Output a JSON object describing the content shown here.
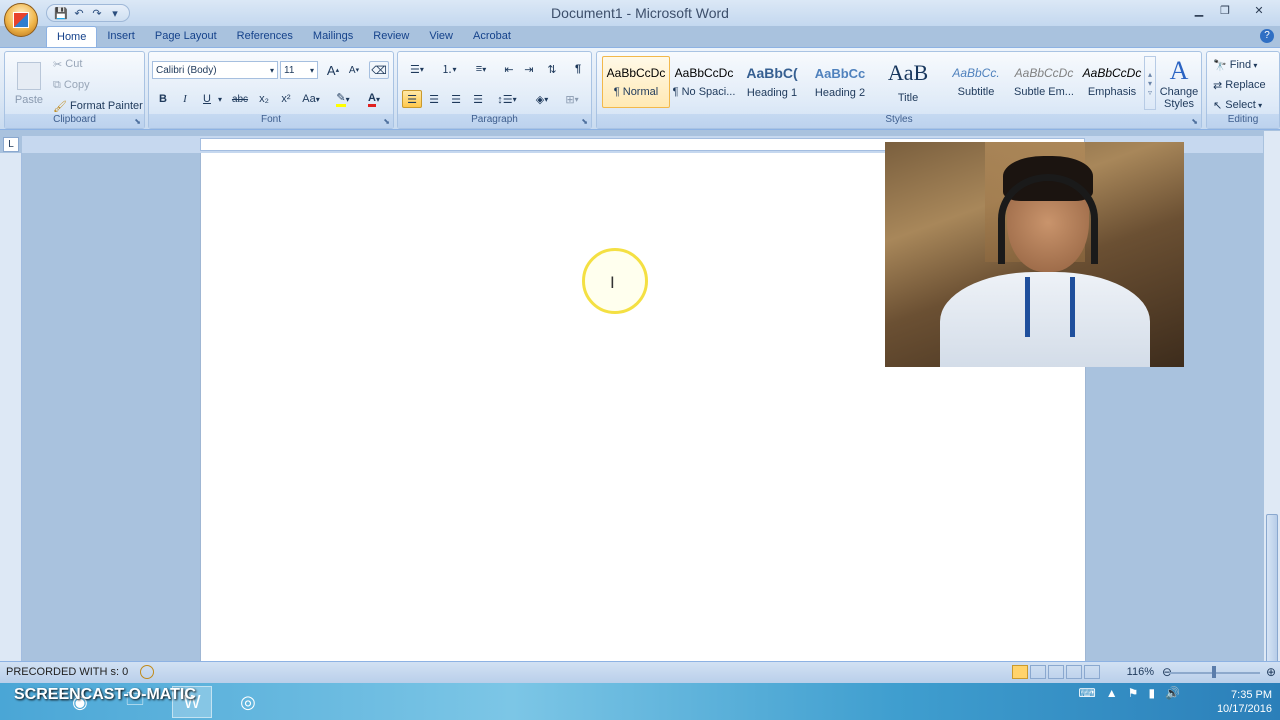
{
  "window": {
    "title": "Document1 - Microsoft Word"
  },
  "qat": {
    "save": "💾",
    "undo": "↶",
    "redo": "↷",
    "more": "▾"
  },
  "tabs": [
    "Home",
    "Insert",
    "Page Layout",
    "References",
    "Mailings",
    "Review",
    "View",
    "Acrobat"
  ],
  "clipboard": {
    "paste": "Paste",
    "cut": "Cut",
    "copy": "Copy",
    "format_painter": "Format Painter",
    "label": "Clipboard"
  },
  "font": {
    "name": "Calibri (Body)",
    "size": "11",
    "bold": "B",
    "italic": "I",
    "underline": "U",
    "strike": "abc",
    "sub": "x₂",
    "sup": "x²",
    "case": "Aa",
    "grow": "A",
    "shrink": "A",
    "label": "Font"
  },
  "paragraph": {
    "label": "Paragraph",
    "pilcrow": "¶"
  },
  "styles": {
    "items": [
      {
        "preview": "AaBbCcDc",
        "name": "¶ Normal"
      },
      {
        "preview": "AaBbCcDc",
        "name": "¶ No Spaci..."
      },
      {
        "preview": "AaBbC(",
        "name": "Heading 1"
      },
      {
        "preview": "AaBbCc",
        "name": "Heading 2"
      },
      {
        "preview": "AaB",
        "name": "Title"
      },
      {
        "preview": "AaBbCc.",
        "name": "Subtitle"
      },
      {
        "preview": "AaBbCcDc",
        "name": "Subtle Em..."
      },
      {
        "preview": "AaBbCcDc",
        "name": "Emphasis"
      }
    ],
    "change": "Change Styles",
    "label": "Styles"
  },
  "editing": {
    "find": "Find",
    "replace": "Replace",
    "select": "Select",
    "label": "Editing"
  },
  "ruler": {
    "tab_selector": "L"
  },
  "status": {
    "left": "PRECORDED WITH s: 0",
    "zoom": "116%"
  },
  "taskbar": {
    "watermark": "SCREENCAST-O-MATIC",
    "time": "7:35 PM",
    "date": "10/17/2016"
  }
}
